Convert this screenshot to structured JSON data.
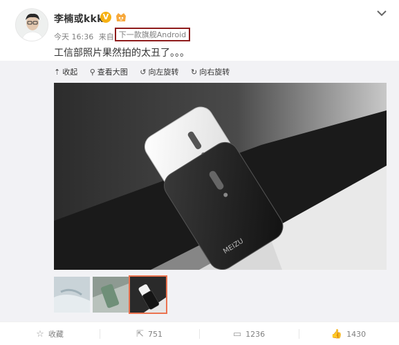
{
  "post": {
    "author": "李楠或kkk",
    "verified_mark": "V",
    "time": "今天 16:36",
    "from_label": "来自",
    "source": "下一款旗舰Android",
    "text": "工信部照片果然拍的太丑了。。。"
  },
  "toolbar": {
    "collapse": "收起",
    "view_large": "查看大图",
    "rotate_left": "向左旋转",
    "rotate_right": "向右旋转"
  },
  "phone_brand": "MEIZU",
  "footer": {
    "favorite": "收藏",
    "repost_count": "751",
    "comment_count": "1236",
    "like_count": "1430"
  },
  "colors": {
    "source_highlight": "#8e1b1b",
    "selected_thumb": "#eb7350",
    "verified": "#f6b114"
  }
}
